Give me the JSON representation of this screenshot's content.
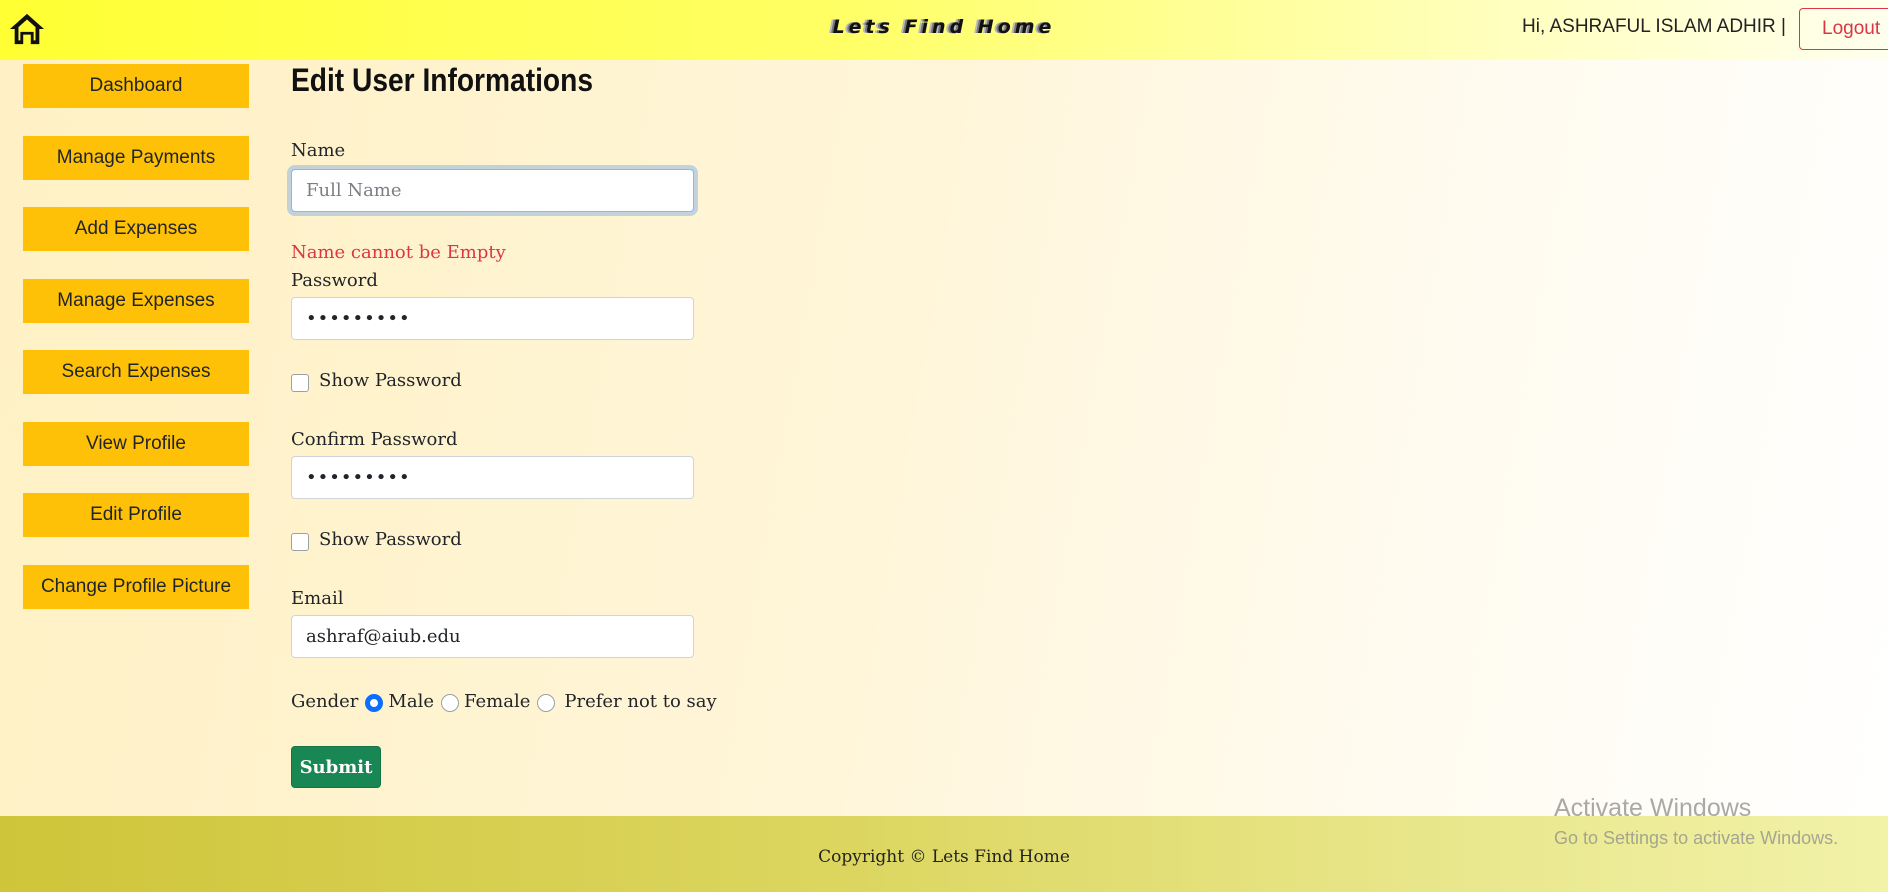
{
  "header": {
    "home_icon": "home-icon",
    "brand": "Lets Find Home",
    "greeting": "Hi, ASHRAFUL ISLAM ADHIR |",
    "logout_label": "Logout"
  },
  "sidebar": {
    "items": [
      {
        "label": "Dashboard"
      },
      {
        "label": "Manage Payments"
      },
      {
        "label": "Add Expenses"
      },
      {
        "label": "Manage Expenses"
      },
      {
        "label": "Search Expenses"
      },
      {
        "label": "View Profile"
      },
      {
        "label": "Edit Profile"
      },
      {
        "label": "Change Profile Picture"
      }
    ]
  },
  "form": {
    "title": "Edit User Informations",
    "name": {
      "label": "Name",
      "value": "",
      "placeholder": "Full Name",
      "error": "Name cannot be Empty"
    },
    "password": {
      "label": "Password",
      "value": "•••••••••",
      "show_label": "Show Password"
    },
    "confirm_password": {
      "label": "Confirm Password",
      "value": "•••••••••",
      "show_label": "Show Password"
    },
    "email": {
      "label": "Email",
      "value": "ashraf@aiub.edu"
    },
    "gender": {
      "label": "Gender",
      "options": [
        "Male",
        "Female",
        "Prefer not to say"
      ],
      "selected": "Male"
    },
    "submit_label": "Submit"
  },
  "footer": {
    "copyright": "Copyright © Lets Find Home"
  },
  "watermark": {
    "title": "Activate Windows",
    "subtitle": "Go to Settings to activate Windows."
  },
  "colors": {
    "sidebar_button": "#ffc107",
    "error_text": "#dc3545",
    "submit_button": "#198754",
    "logout_border": "#dc3545",
    "radio_selected": "#0d6efd"
  }
}
